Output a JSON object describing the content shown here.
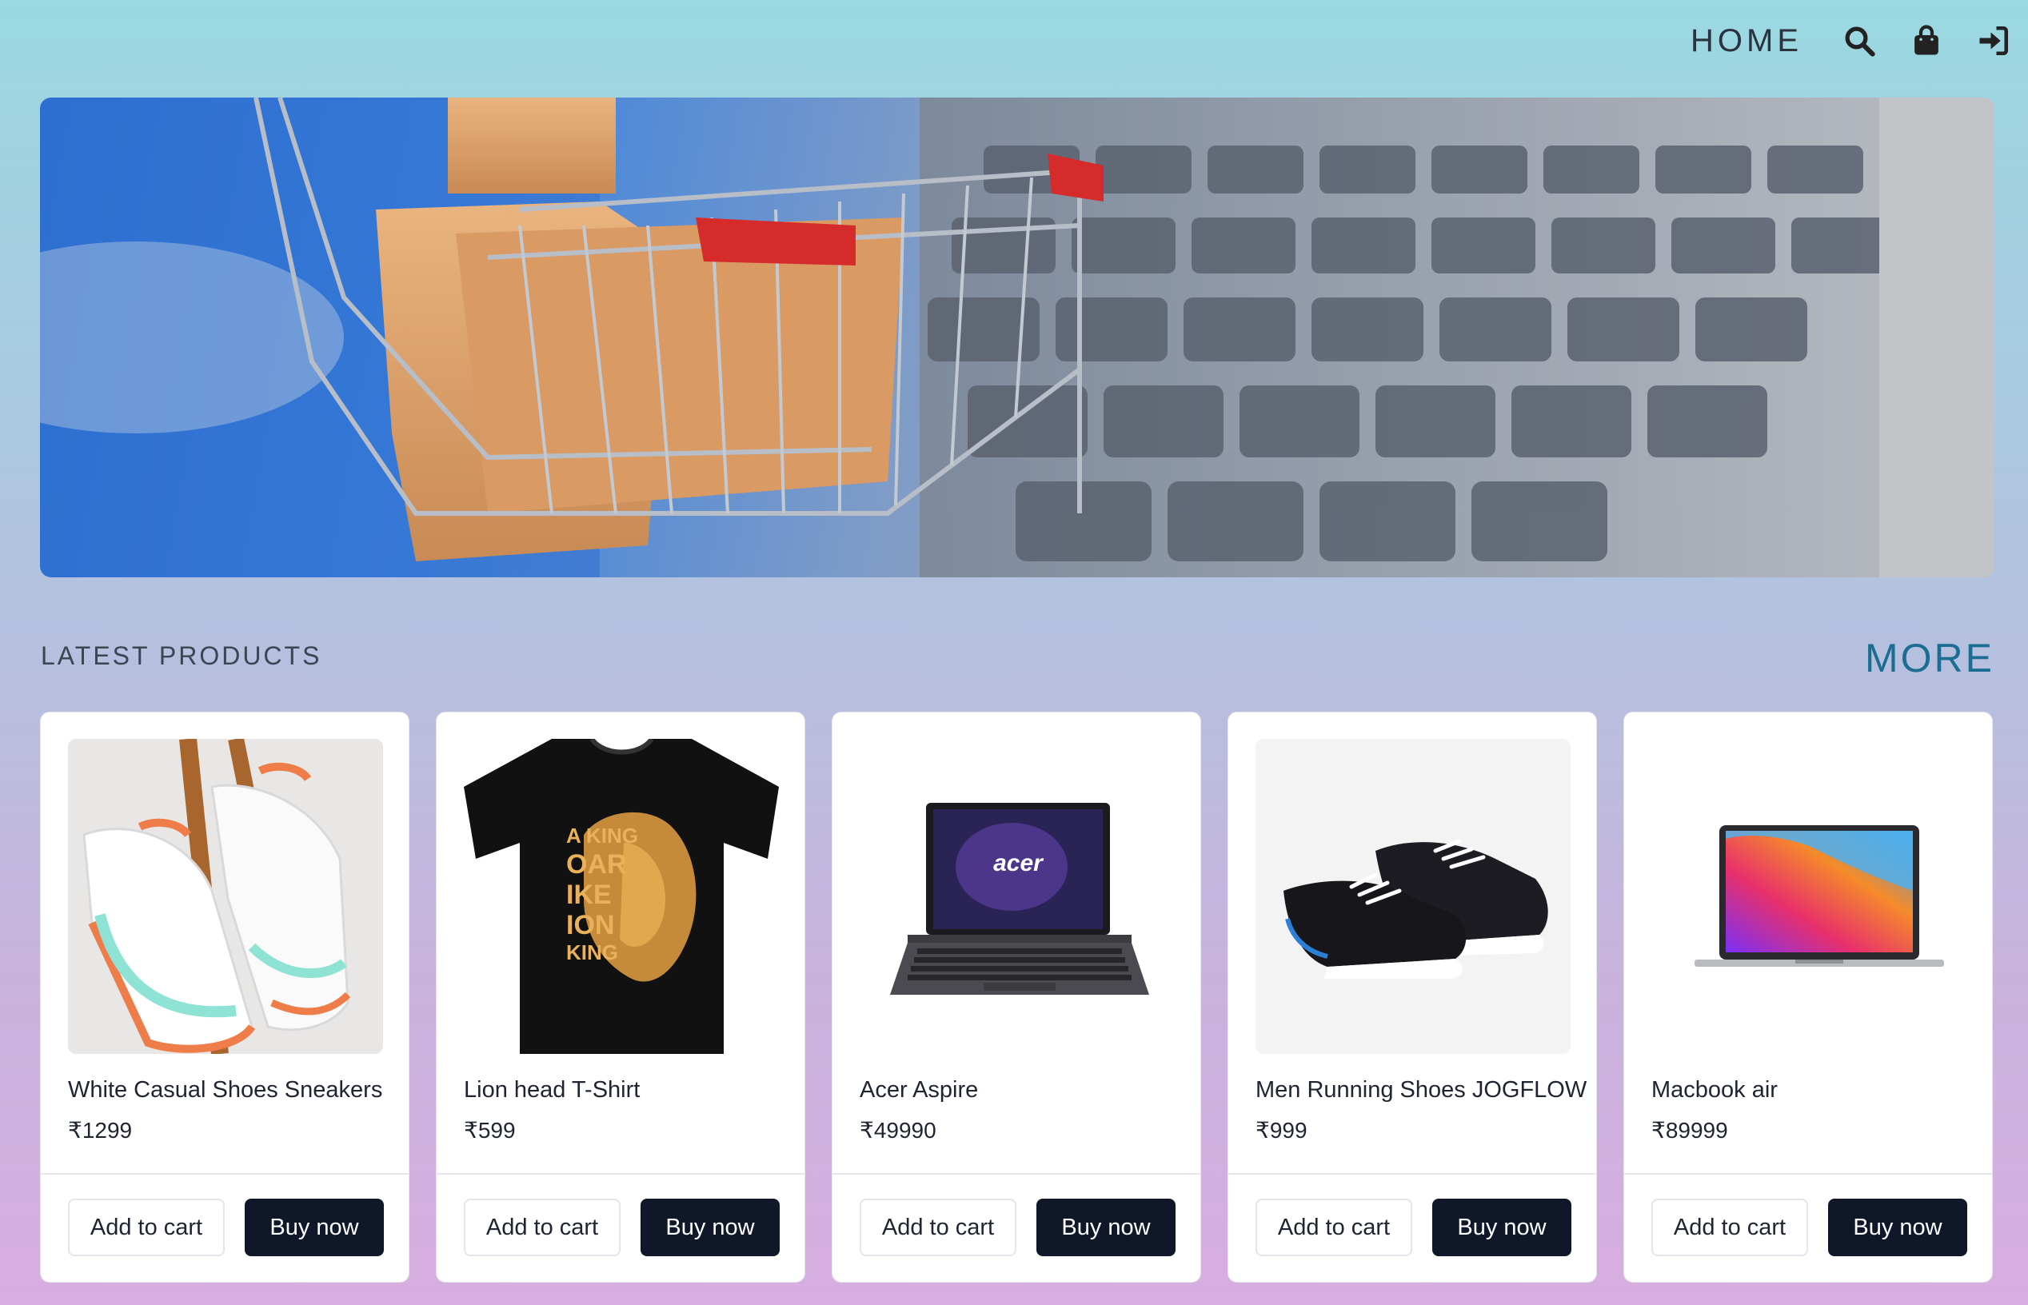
{
  "nav": {
    "home_label": "HOME",
    "icons": [
      "search-icon",
      "shopping-bag-icon",
      "sign-in-icon"
    ]
  },
  "hero": {
    "image": "shopping-cart-with-boxes-on-laptop-keyboard"
  },
  "section": {
    "title": "LATEST PRODUCTS",
    "more_label": "MORE"
  },
  "products": [
    {
      "title": "White Casual Shoes Sneakers",
      "price": "₹1299",
      "image": "white-sneakers",
      "add_label": "Add to cart",
      "buy_label": "Buy now"
    },
    {
      "title": "Lion head T-Shirt",
      "price": "₹599",
      "image": "lion-tshirt",
      "add_label": "Add to cart",
      "buy_label": "Buy now"
    },
    {
      "title": "Acer Aspire",
      "price": "₹49990",
      "image": "acer-laptop",
      "add_label": "Add to cart",
      "buy_label": "Buy now"
    },
    {
      "title": "Men Running Shoes JOGFLOW",
      "price": "₹999",
      "image": "black-running-shoes",
      "add_label": "Add to cart",
      "buy_label": "Buy now"
    },
    {
      "title": "Macbook air",
      "price": "₹89999",
      "image": "macbook-air",
      "add_label": "Add to cart",
      "buy_label": "Buy now"
    }
  ],
  "colors": {
    "primary_button": "#0f1729",
    "more_link": "#1b6e92",
    "accent_red": "#d62b2b"
  }
}
